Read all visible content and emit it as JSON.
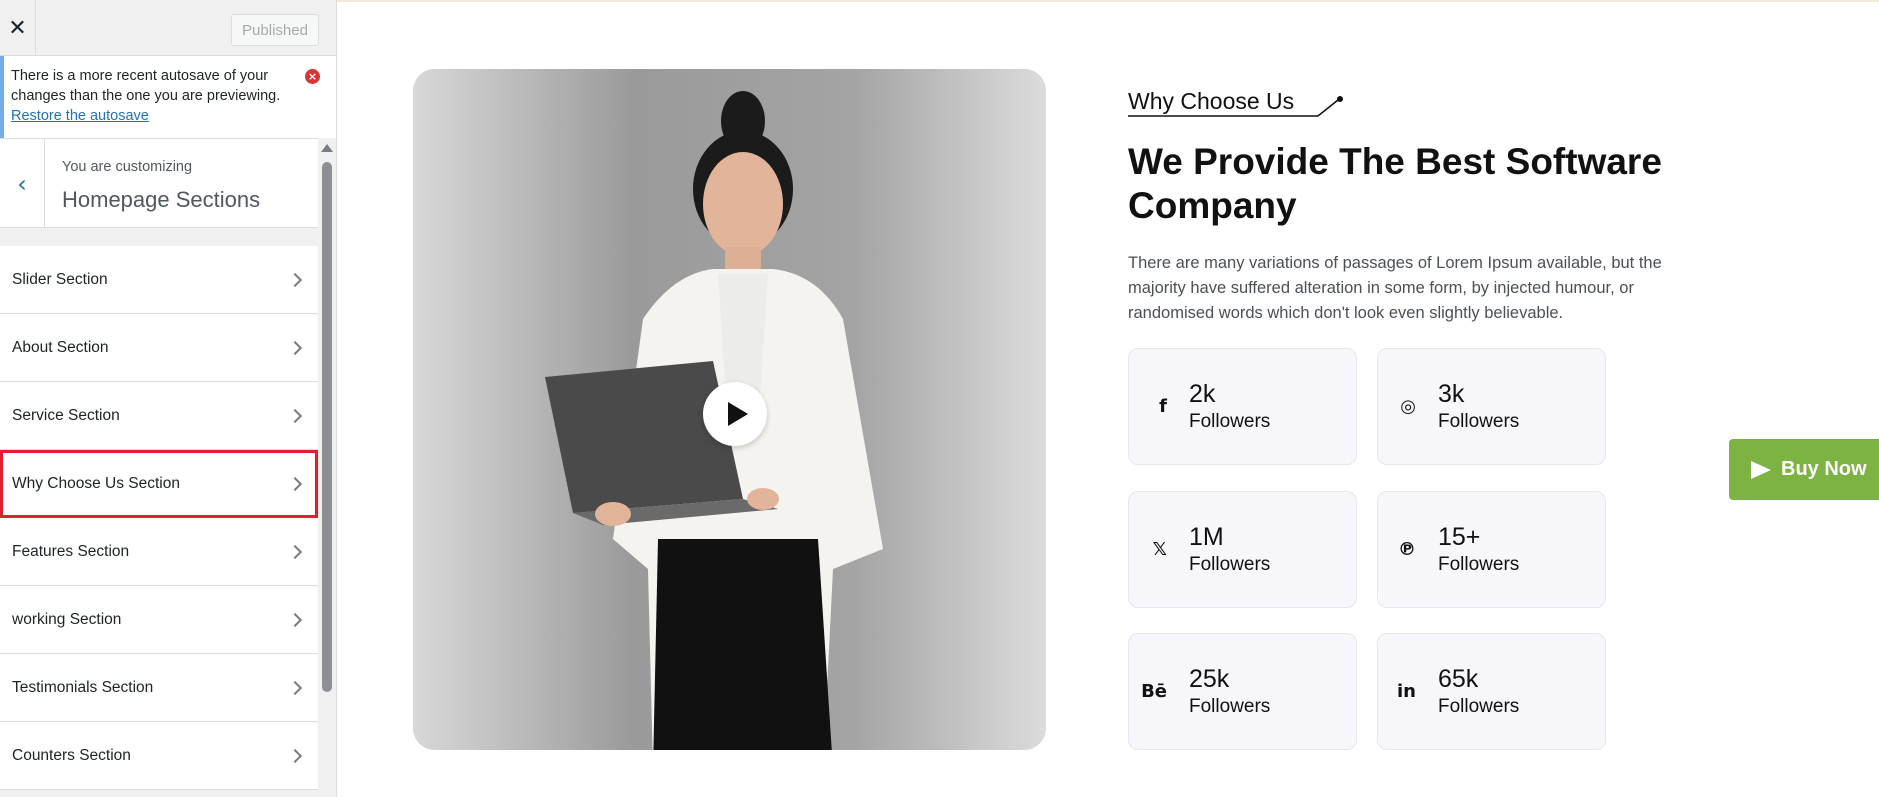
{
  "sidebar": {
    "close_symbol": "✕",
    "publish_label": "Published",
    "autosave": {
      "message": "There is a more recent autosave of your changes than the one you are previewing.",
      "link": "Restore the autosave",
      "dismiss_symbol": "×"
    },
    "panel": {
      "back_symbol": "‹",
      "subtitle": "You are customizing",
      "title": "Homepage Sections"
    },
    "sections": [
      {
        "label": "Slider Section"
      },
      {
        "label": "About Section"
      },
      {
        "label": "Service Section"
      },
      {
        "label": "Why Choose Us Section",
        "highlighted": true
      },
      {
        "label": "Features Section"
      },
      {
        "label": "working Section"
      },
      {
        "label": "Testimonials Section"
      },
      {
        "label": "Counters Section"
      }
    ]
  },
  "preview": {
    "eyebrow": "Why Choose Us",
    "heading": "We Provide The Best Software Company",
    "description": "There are many variations of passages of Lorem Ipsum available, but the majority have suffered alteration in some form, by injected humour, or randomised words which don't look even slightly believable.",
    "stats": [
      {
        "icon": "facebook-icon",
        "glyph": "f",
        "value": "2k",
        "label": "Followers"
      },
      {
        "icon": "instagram-icon",
        "glyph": "◎",
        "value": "3k",
        "label": "Followers"
      },
      {
        "icon": "x-twitter-icon",
        "glyph": "𝕏",
        "value": "1M",
        "label": "Followers"
      },
      {
        "icon": "pinterest-icon",
        "glyph": "℗",
        "value": "15+",
        "label": "Followers"
      },
      {
        "icon": "behance-icon",
        "glyph": "Bē",
        "value": "25k",
        "label": "Followers"
      },
      {
        "icon": "linkedin-icon",
        "glyph": "in",
        "value": "65k",
        "label": "Followers"
      }
    ],
    "buy_now": "Buy Now"
  },
  "colors": {
    "accent_green": "#7cb342",
    "link_blue": "#2271b1",
    "highlight_red": "#e0202e"
  }
}
